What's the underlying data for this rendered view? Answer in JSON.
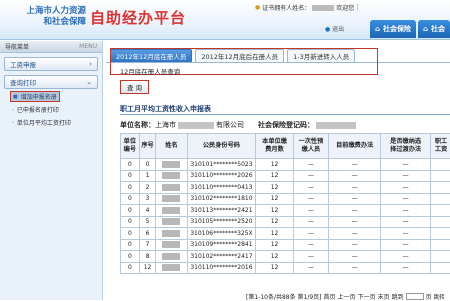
{
  "header": {
    "logo_line1": "上海市人力资源",
    "logo_line2": "和社会保障",
    "app_title": "自助经办平台",
    "user_prefix": "证书拥有人姓名：",
    "user_suffix": "欢迎您",
    "exit": "退出",
    "nav_tabs": [
      "社会保险",
      "社会"
    ]
  },
  "sidebar": {
    "title": "导航菜单",
    "menu_tag": "MENU",
    "items": [
      {
        "label": "工资申报"
      },
      {
        "label": "查询打印"
      }
    ],
    "subitems": [
      {
        "label": "增加申报名册",
        "active": true
      },
      {
        "label": "已申报名册打印",
        "active": false
      },
      {
        "label": "单位月平均工资打印",
        "active": false
      }
    ]
  },
  "main": {
    "tabs": [
      {
        "label": "2012年12月底在册人员",
        "active": true
      },
      {
        "label": "2012年12月底后在册人员",
        "active": false
      },
      {
        "label": "1-3月新进转入人员",
        "active": false
      }
    ],
    "query_title": "12月底在册人员查询",
    "query_button": "查 询",
    "report_title": "职工月平均工资性收入申报表",
    "unit_name_label": "单位名称：",
    "unit_name_prefix": "上海市",
    "unit_name_suffix": "有限公司",
    "social_code_label": "社会保险登记码："
  },
  "table": {
    "headers": [
      "单位\n编号",
      "序号",
      "姓名",
      "公民身份号码",
      "本单位缴\n费月数",
      "一次性预\n缴人员",
      "目前缴费办法",
      "是否缴纳选\n择过渡办法",
      "职工\n工资"
    ],
    "rows": [
      [
        "0",
        "0",
        "",
        "310101********5023",
        "12",
        "—",
        "—",
        "—",
        ""
      ],
      [
        "0",
        "1",
        "",
        "310110********2026",
        "12",
        "—",
        "—",
        "—",
        ""
      ],
      [
        "0",
        "2",
        "",
        "310110********0413",
        "12",
        "—",
        "—",
        "—",
        ""
      ],
      [
        "0",
        "3",
        "",
        "310102********1810",
        "12",
        "—",
        "—",
        "—",
        ""
      ],
      [
        "0",
        "4",
        "",
        "310113********2421",
        "12",
        "—",
        "—",
        "—",
        ""
      ],
      [
        "0",
        "5",
        "",
        "310105********2520",
        "12",
        "—",
        "—",
        "—",
        ""
      ],
      [
        "0",
        "6",
        "",
        "310106********325X",
        "12",
        "—",
        "—",
        "—",
        ""
      ],
      [
        "0",
        "7",
        "",
        "310109********2841",
        "12",
        "—",
        "—",
        "—",
        ""
      ],
      [
        "0",
        "8",
        "",
        "310102********2417",
        "12",
        "—",
        "—",
        "—",
        ""
      ],
      [
        "0",
        "12",
        "",
        "310110********2016",
        "12",
        "—",
        "—",
        "—",
        ""
      ]
    ]
  },
  "pager": {
    "text": "[第1-10条/共88条 第1/9页]",
    "first": "首页",
    "prev": "上一页",
    "next": "下一页",
    "last": "末页",
    "jump_label": "跳到",
    "page_unit": "页",
    "go": "跳转"
  }
}
